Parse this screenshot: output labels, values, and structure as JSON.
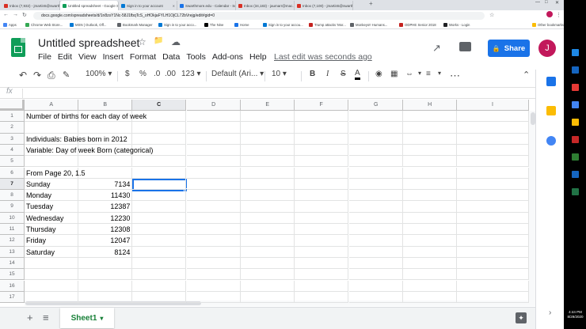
{
  "browser": {
    "tabs": [
      {
        "label": "Inbox (7,932) - jmartin5@swarth...",
        "color": "#d93025",
        "active": false
      },
      {
        "label": "Untitled spreadsheet - Google Sh...",
        "color": "#0f9d58",
        "active": true
      },
      {
        "label": "Sign in to your account",
        "color": "#0078d4",
        "active": false
      },
      {
        "label": "Swarthmore.edu - Calendar - Sc...",
        "color": "#1a73e8",
        "active": false
      },
      {
        "label": "Inbox (34,183) - jaumarr@mac...",
        "color": "#d93025",
        "active": false
      },
      {
        "label": "Inbox (7,100) - jmartin5@swarth...",
        "color": "#d93025",
        "active": false
      }
    ],
    "new_tab_glyph": "+",
    "url": "docs.google.com/spreadsheets/d/1n8zsY1Nc-58J1fbqTcS_oHOkjaFYLH1OjCL72bVrejg/edit#gid=0",
    "bookmarks": [
      {
        "label": "Apps",
        "color": "#4285f4"
      },
      {
        "label": "Chrome Web Store...",
        "color": "#34a853"
      },
      {
        "label": "MSN | Outlook, Off...",
        "color": "#0078d4"
      },
      {
        "label": "Bookmark Manager",
        "color": "#5f6368"
      },
      {
        "label": "Sign in to your acco...",
        "color": "#0078d4"
      },
      {
        "label": "The Nine",
        "color": "#000000"
      },
      {
        "label": "Home",
        "color": "#1a73e8"
      },
      {
        "label": "Sign in to your accou...",
        "color": "#0078d4"
      },
      {
        "label": "Trump attacks 'Mor...",
        "color": "#c5221f"
      },
      {
        "label": "Monkeys!! Humans...",
        "color": "#5f6368"
      },
      {
        "label": "ODPHE Senior 2018",
        "color": "#c5221f"
      },
      {
        "label": "Works - Login",
        "color": "#202124"
      }
    ],
    "other_bookmarks": "Other bookmarks"
  },
  "app": {
    "title": "Untitled spreadsheet",
    "menu": [
      "File",
      "Edit",
      "View",
      "Insert",
      "Format",
      "Data",
      "Tools",
      "Add-ons",
      "Help"
    ],
    "last_edit": "Last edit was seconds ago",
    "share_label": "Share",
    "avatar_initial": "J"
  },
  "toolbar": {
    "zoom": "100%",
    "currency": "$",
    "percent": "%",
    "dec_decrease": ".0",
    "dec_increase": ".00",
    "more_formats": "123",
    "font": "Default (Ari...",
    "font_size": "10",
    "bold": "B",
    "italic": "I",
    "strike": "S",
    "text_color": "A"
  },
  "formula_bar": {
    "fx": "fx",
    "value": ""
  },
  "sheet": {
    "columns": [
      "A",
      "B",
      "C",
      "D",
      "E",
      "F",
      "G",
      "H",
      "I"
    ],
    "selected_column": "C",
    "selected_row": 7,
    "rows": [
      {
        "n": "1",
        "a": "Number of births for each day of week",
        "b": ""
      },
      {
        "n": "2",
        "a": "",
        "b": ""
      },
      {
        "n": "3",
        "a": "Individuals: Babies born in 2012",
        "b": ""
      },
      {
        "n": "4",
        "a": "Variable: Day of week Born (categorical)",
        "b": ""
      },
      {
        "n": "5",
        "a": "",
        "b": ""
      },
      {
        "n": "6",
        "a": "From Page 20, 1.5",
        "b": ""
      },
      {
        "n": "7",
        "a": "Sunday",
        "b": "7134"
      },
      {
        "n": "8",
        "a": "Monday",
        "b": "11430"
      },
      {
        "n": "9",
        "a": "Tuesday",
        "b": "12387"
      },
      {
        "n": "10",
        "a": "Wednesday",
        "b": "12230"
      },
      {
        "n": "11",
        "a": "Thursday",
        "b": "12308"
      },
      {
        "n": "12",
        "a": "Friday",
        "b": "12047"
      },
      {
        "n": "13",
        "a": "Saturday",
        "b": "8124"
      },
      {
        "n": "14",
        "a": "",
        "b": ""
      },
      {
        "n": "15",
        "a": "",
        "b": ""
      },
      {
        "n": "16",
        "a": "",
        "b": ""
      },
      {
        "n": "17",
        "a": "",
        "b": ""
      }
    ]
  },
  "bottom": {
    "sheet_tab": "Sheet1",
    "add_sheet": "+",
    "all_sheets": "≡"
  },
  "taskbar": {
    "time": "4:44 PM",
    "date": "8/29/2020",
    "apps": [
      "#1e88e5",
      "#1565c0",
      "#e53935",
      "#4285f4",
      "#fbbc04",
      "#c62828",
      "#2e7d32",
      "#1565c0",
      "#217346"
    ]
  },
  "side_panel": {
    "icons": [
      "#1a73e8",
      "#fbbc04",
      "#4285f4"
    ]
  }
}
